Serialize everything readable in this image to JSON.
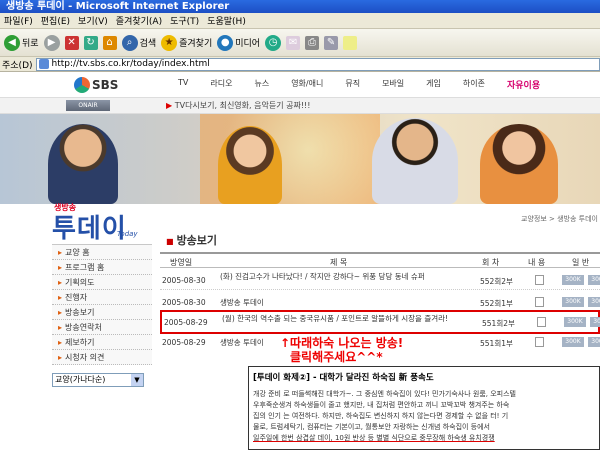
{
  "window": {
    "title": "생방송 투데이 - Microsoft Internet Explorer"
  },
  "menu": [
    "파일(F)",
    "편집(E)",
    "보기(V)",
    "즐겨찾기(A)",
    "도구(T)",
    "도움말(H)"
  ],
  "toolbar": {
    "back": "뒤로",
    "search": "검색",
    "favorites": "즐겨찾기",
    "media": "미디어"
  },
  "address": {
    "label": "주소(D)",
    "url": "http://tv.sbs.co.kr/today/index.html"
  },
  "sbs": {
    "logo": "SBS",
    "nav": [
      "TV",
      "라디오",
      "뉴스",
      "영화/애니",
      "뮤직",
      "모바일",
      "게임",
      "하이존"
    ],
    "nav_hot": "자유이용",
    "onair": "ONAIR",
    "ticker_prefix": "▶",
    "ticker": "TV다시보기, 최신영화, 음악듣기 공짜!!!"
  },
  "side": {
    "logo_small": "생방송",
    "logo_big": "투데이",
    "logo_tag": "Today",
    "items": [
      "교양 홈",
      "프로그램 홈",
      "기획의도",
      "진행자",
      "방송보기",
      "방송연락처",
      "제보하기",
      "시청자 의견"
    ],
    "select": "교양(가나다순)"
  },
  "main": {
    "breadcrumb": "교양정보 > 생방송 투데이",
    "section": "방송보기",
    "headers": {
      "date": "방영일",
      "title": "제 목",
      "episode": "회 차",
      "content": "내 용",
      "view": "일 반"
    },
    "rows": [
      {
        "date": "2005-08-30",
        "title": "(화) 진검고수가 나타났다! / 작지만 강하다~ 위풍 당당 동네 슈퍼",
        "ep": "552회2부",
        "v1": "300K",
        "v2": "300K"
      },
      {
        "date": "2005-08-30",
        "title": "생방송 투데이",
        "ep": "552회1부",
        "v1": "300K",
        "v2": "300K"
      },
      {
        "date": "2005-08-29",
        "title": "(월) 한국의 역수출 되는 중국유시품 / 포인트로 알뜰하게 시장을 즐겨라!",
        "ep": "551회2부",
        "v1": "300K",
        "v2": "300K"
      },
      {
        "date": "2005-08-29",
        "title": "생방송 투데이",
        "ep": "551회1부",
        "v1": "300K",
        "v2": "300K"
      }
    ],
    "annotation_line1": "↑따래하숙 나오는 방송!",
    "annotation_line2": "클릭해주세요^^*",
    "article_title": "[투데이 화제②] - 대학가 달라진 하숙집 新 풍속도",
    "article_body_1": "개강 준비 로 떠들썩해진 대학가~. 그 중심엔 하숙집이 있다! 민가기숙사나 원룸, 오피스텔",
    "article_body_2": "우후죽순생겨 하숙생들이 줄고 했지만, 내 집처럼 편안하고 끼니 꼬박꼬박 챙겨주는 하숙",
    "article_body_3": "집의 인기 는 여전하다. 하지만, 하숙집도 변신하지 하지 않는다면 경제할 수 없을 터! 기",
    "article_body_4": "물로, 트럼세탁기, 컴퓨터는 기본이고, 월통보안 자랑하는 신개념 하숙집이 등에서",
    "article_body_5": "일주일에 한번 삼겹살 데이, 10원 반상 등 별별 식단으로 중무장해 하숙생 유치경쟁"
  }
}
